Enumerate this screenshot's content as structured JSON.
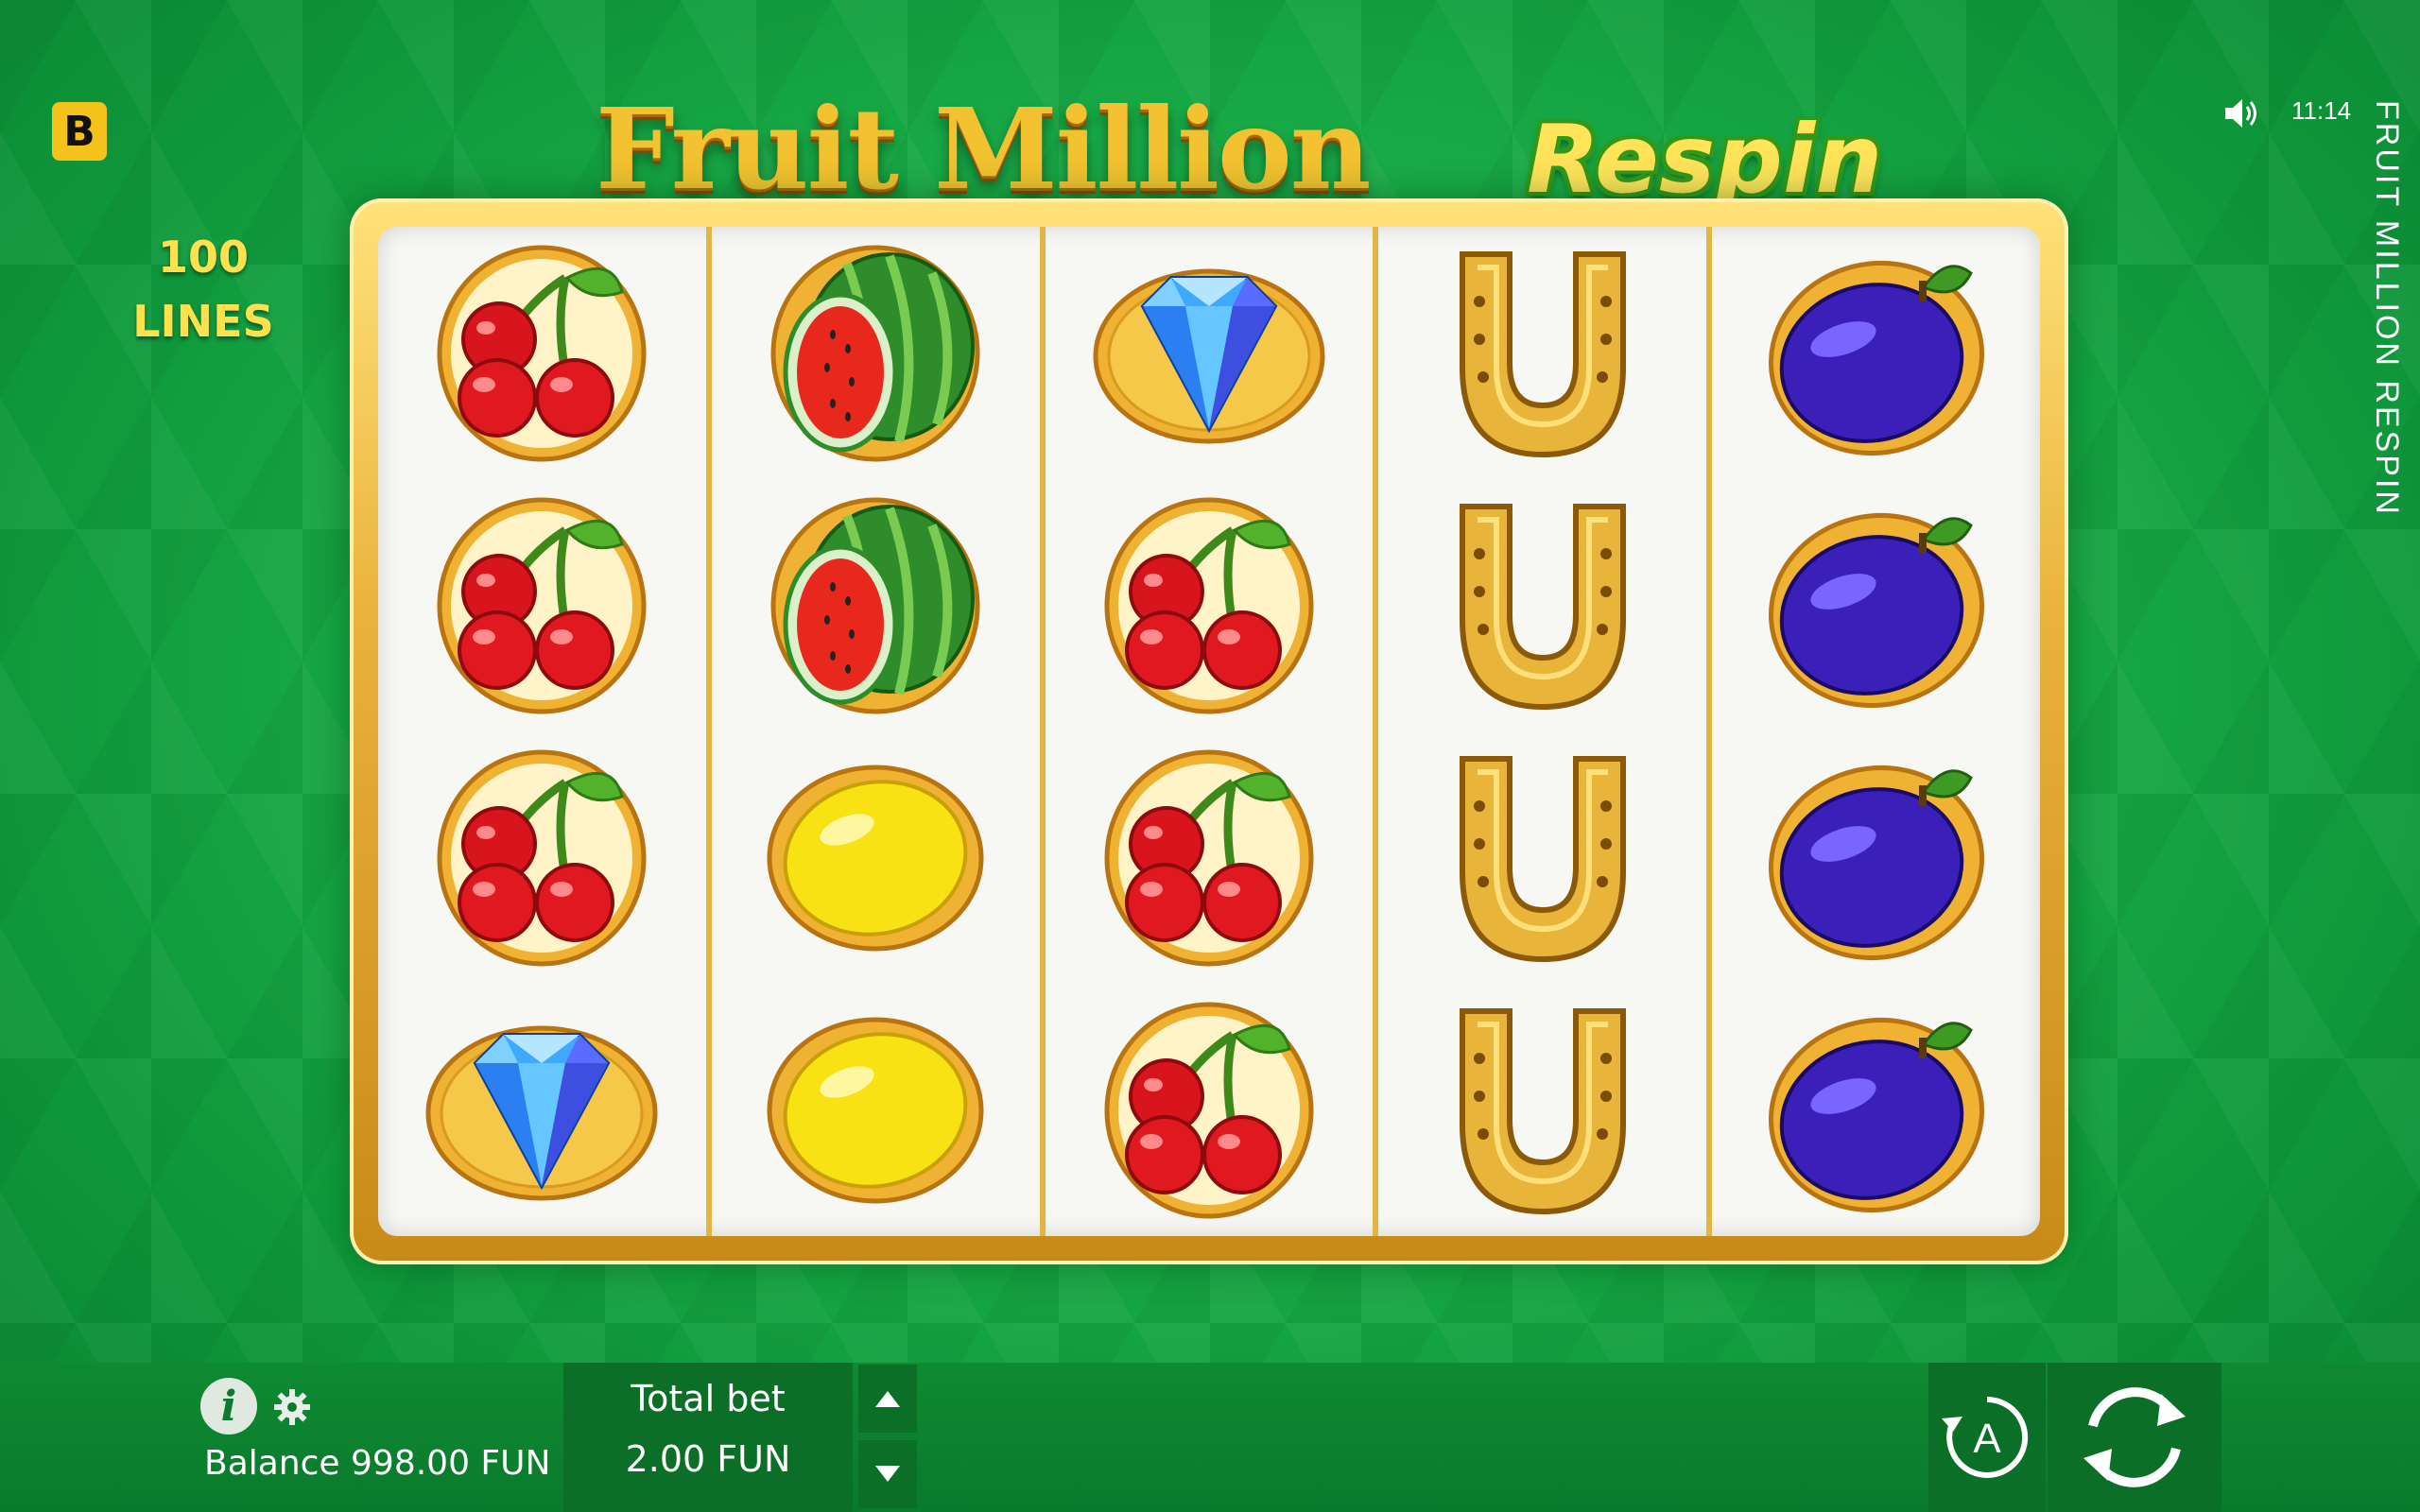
{
  "brand": {
    "badge_letter": "B"
  },
  "lines": {
    "count": "100",
    "label": "LINES"
  },
  "logo": {
    "title": "Fruit Million",
    "subtitle": "Respin"
  },
  "status": {
    "time": "11:14",
    "sound_icon": "speaker-icon"
  },
  "side_title": "FRUIT MILLION RESPIN",
  "reels": [
    [
      "cherry",
      "cherry",
      "cherry",
      "diamond"
    ],
    [
      "watermelon",
      "watermelon",
      "lemon",
      "lemon"
    ],
    [
      "diamond",
      "cherry",
      "cherry",
      "cherry"
    ],
    [
      "horseshoe",
      "horseshoe",
      "horseshoe",
      "horseshoe"
    ],
    [
      "plum",
      "plum",
      "plum",
      "plum"
    ]
  ],
  "bottom": {
    "info_icon": "info-icon",
    "settings_icon": "gear-icon",
    "balance": "Balance 998.00 FUN",
    "bet_label": "Total bet",
    "bet_value": "2.00 FUN",
    "auto_icon": "autoplay-icon",
    "spin_icon": "spin-icon"
  },
  "colors": {
    "background": "#1db24c",
    "frame_gold": "#e9b23a",
    "panel": "#0b6f28",
    "lines_text": "#ffe14d"
  }
}
